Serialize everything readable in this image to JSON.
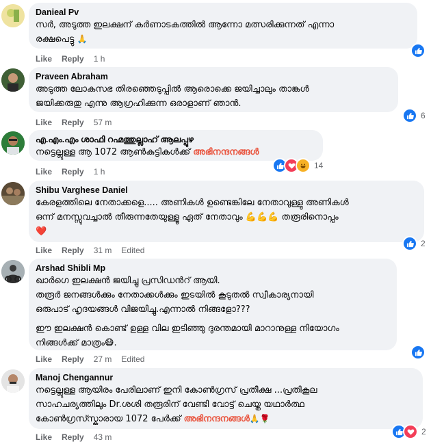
{
  "colors": {
    "like": "#1877f2",
    "love": "#f33e58",
    "haha": "#f7b125",
    "accent": "#e9553f",
    "bubble": "#f0f2f5",
    "meta": "#65676b"
  },
  "actions": {
    "like": "Like",
    "reply": "Reply",
    "edited": "Edited"
  },
  "comments": [
    {
      "name": "Danieal Pv",
      "text": "സർ, അടുത്ത ഇലക്ഷന് കർണാടകത്തിൽ ആന്നോ മത്സരിക്കുന്നത് എന്നാ\nരക്ഷപെട്ടു",
      "emoji": "🙏",
      "time": "1 h",
      "reaction_count": ""
    },
    {
      "name": "Praveen Abraham",
      "text": "അടുത്ത ലോകസഭ തിരഞ്ഞെടുപ്പിൽ ആരൊക്കെ ജയിച്ചാലും താങ്കൾ\nജയിക്കരുതു എന്നു ആഗ്രഹിക്കുന്ന ഒരാളാണ് ഞാൻ.",
      "time": "57 m",
      "reaction_count": "6"
    },
    {
      "name": "എ.എം.എം ശാഫി റഹ്മത്തുല്ലാഹ് ആലപ്പുഴ",
      "text": "നട്ടെല്ലുള്ള ആ 1072 ആൺകുട്ടികൾക്ക്",
      "accent": "അഭിനന്ദനങ്ങൾ",
      "time": "1 h",
      "reaction_count": "14"
    },
    {
      "name": "Shibu Varghese Daniel",
      "text": "കേരളത്തിലെ നേതാക്കളെ..... അണികൾ ഉണ്ടെങ്കിലേ നേതാവുള്ളു അണികൾ\nഒന്ന് മനസ്സുവച്ചാൽ തീരുന്നതേയുള്ളൂ ഏത് നേതാവും 💪💪💪 തരൂരിനൊപ്പം\n❤️",
      "time": "31 m",
      "edited": true,
      "reaction_count": "2"
    },
    {
      "name": "Arshad Shibli Mp",
      "text": "ഖാർഗെ ഇലക്ഷൻ ജയിച്ചു പ്രസിഡൻറ് ആയി.\nതരൂർ ജനങ്ങൾക്കും നേതാക്കൾക്കും ഇടയിൽ കൂടുതൽ സ്വീകാര്യനായി\nഒരുപാട് ഹൃദയങ്ങൾ വിജയിച്ചു.എന്നാൽ നിങ്ങളോ???",
      "text2": "ഈ ഇലക്ഷൻ കൊണ്ട് ഉള്ള വില ഇടിഞ്ഞു ദുരന്തമായി മാറാനുള്ള നിയോഗം\nനിങ്ങൾക്ക് മാത്രം😷.",
      "time": "27 m",
      "edited": true,
      "reaction_count": ""
    },
    {
      "name": "Manoj Chengannur",
      "text": "നട്ടെല്ലുള്ള ആയിരം പേരിലാണ് ഇനി കോൺഗ്രസ് പ്രതീക്ഷ ...പ്രതികൂല\nസാഹചര്യത്തിലും Dr.ശശി തരൂരിന് വേണ്ടി വോട്ട് ചെയ്ത യഥാർത്ഥ\nകോൺഗ്രസ്സ്കാരായ 1072 പേർക്ക്",
      "accent": "അഭിനന്ദനങ്ങൾ",
      "emoji": "🙏🌹",
      "time": "43 m",
      "reaction_count": "2"
    }
  ]
}
